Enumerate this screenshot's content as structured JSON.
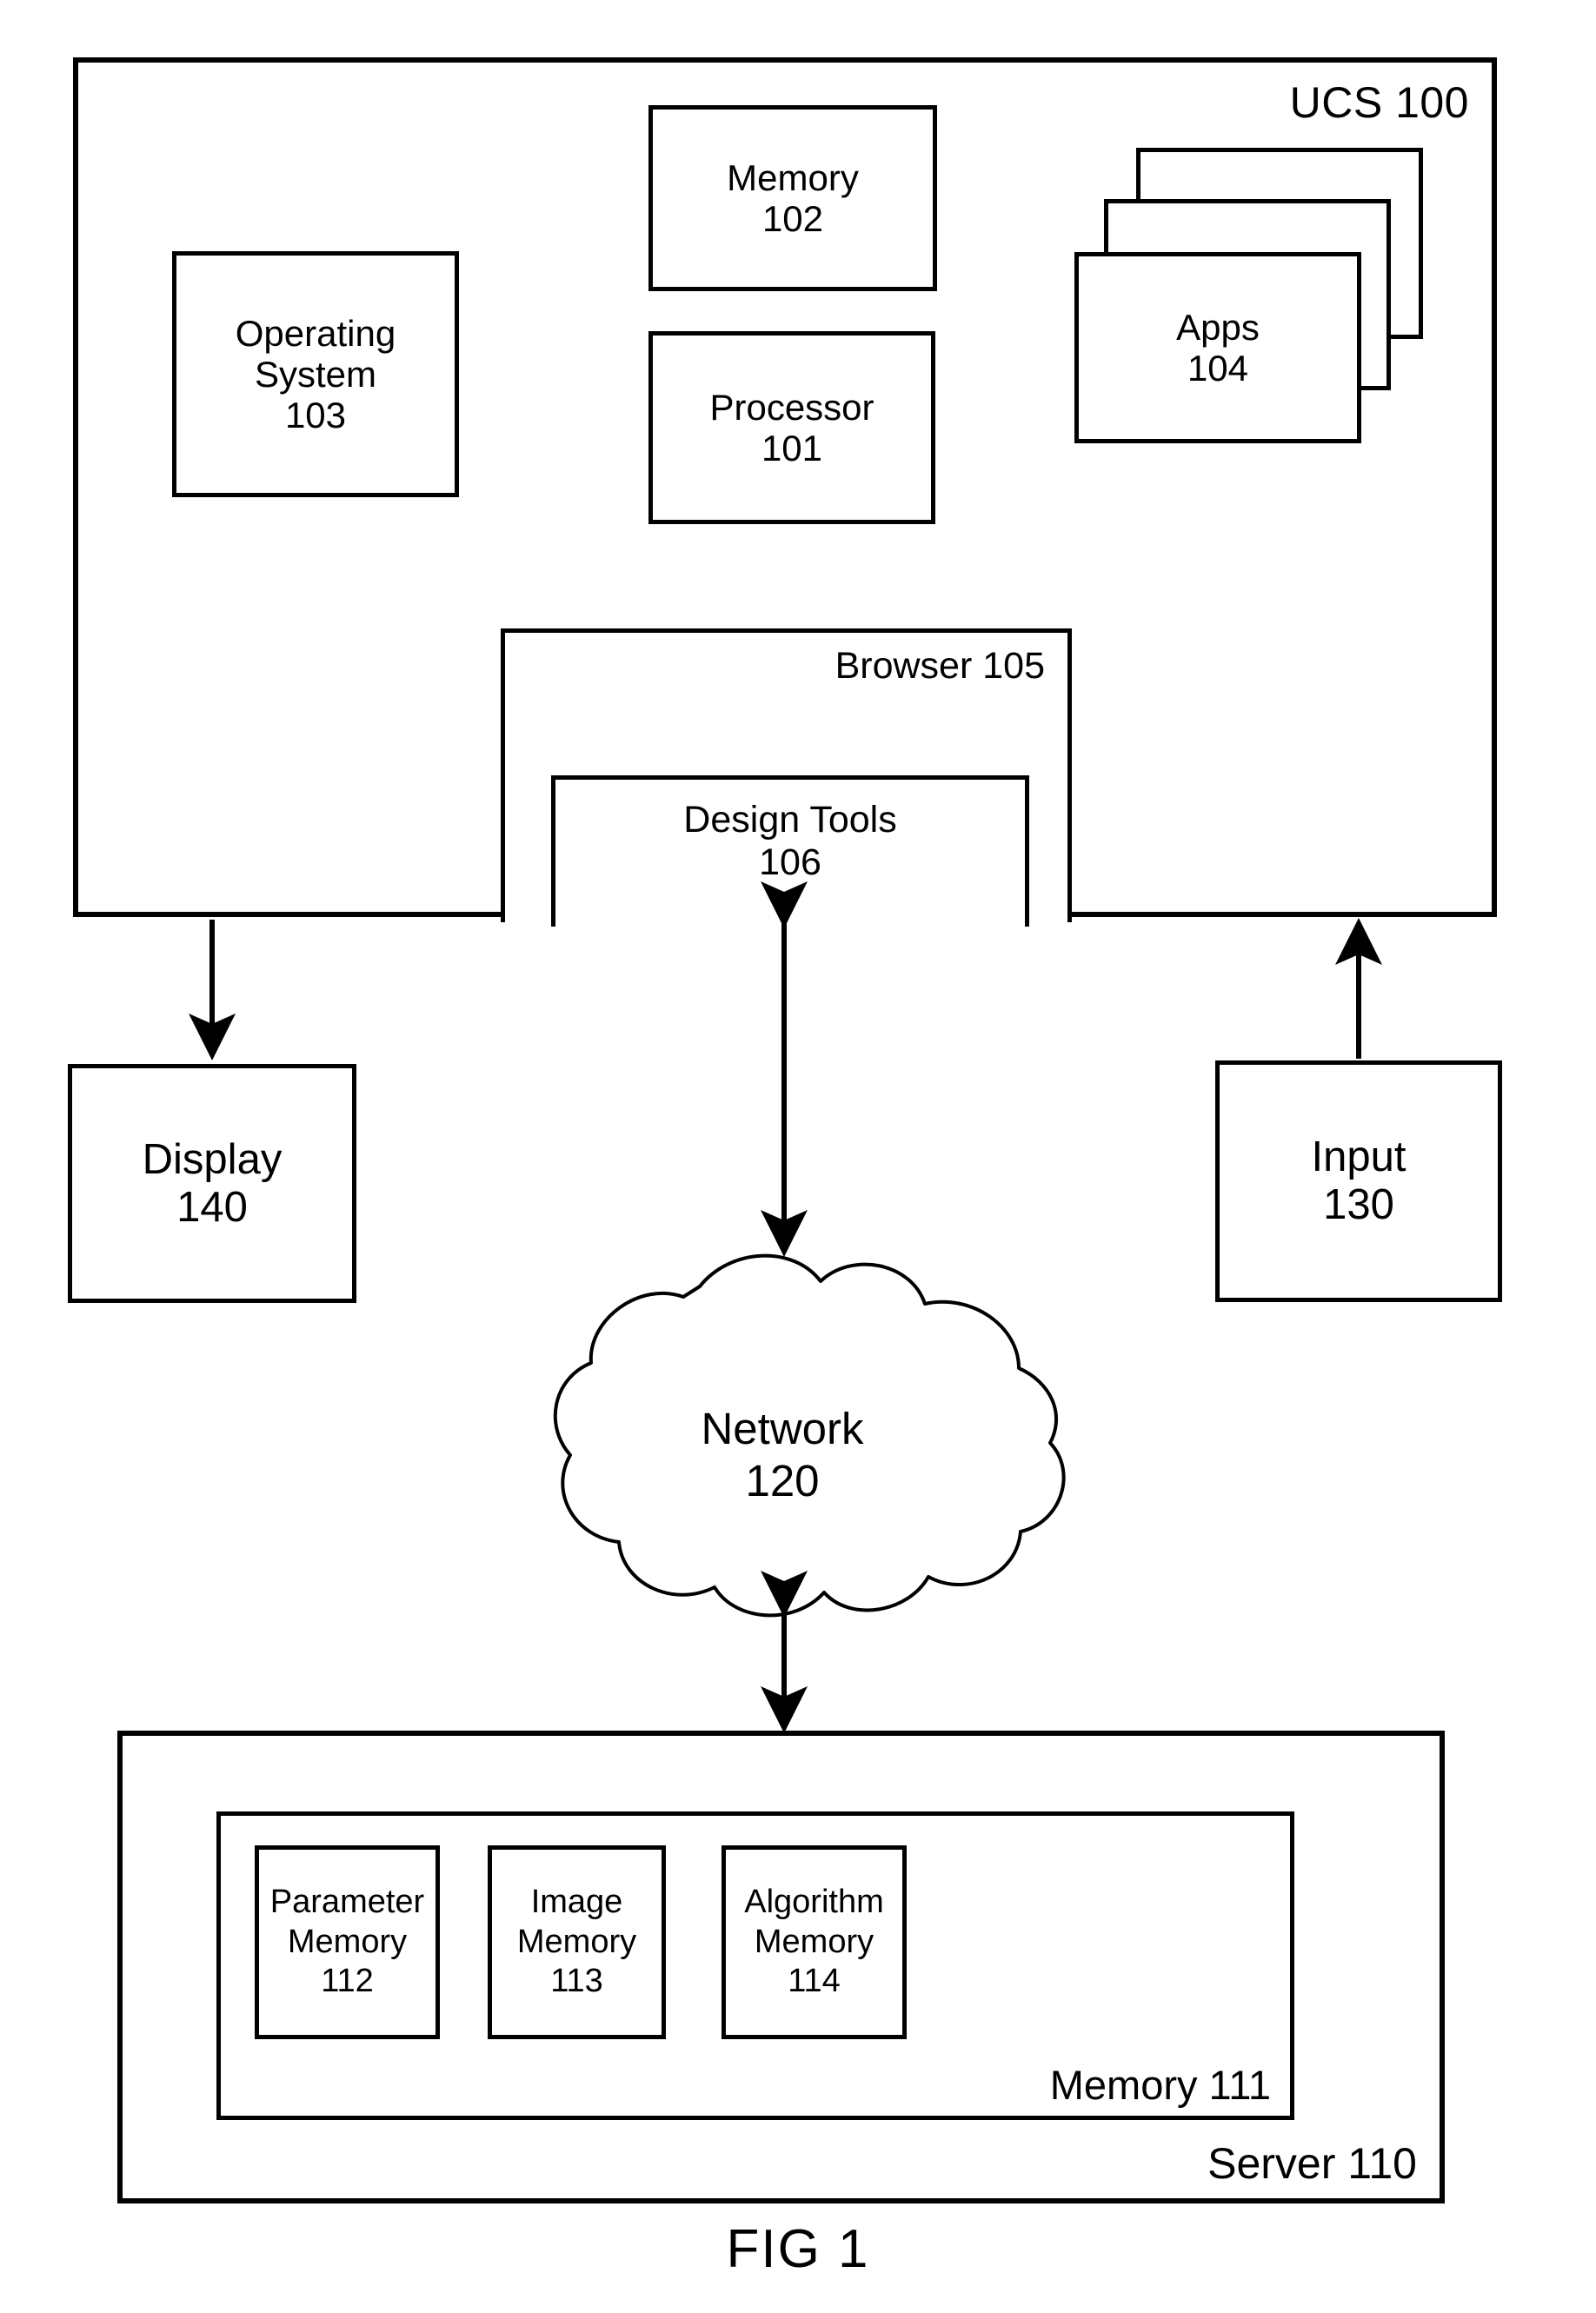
{
  "figure": {
    "caption": "FIG 1"
  },
  "ucs": {
    "title": "UCS 100",
    "operating_system": {
      "name": "Operating System",
      "name_line1": "Operating",
      "name_line2": "System",
      "ref": "103"
    },
    "memory": {
      "name": "Memory",
      "ref": "102"
    },
    "processor": {
      "name": "Processor",
      "ref": "101"
    },
    "apps": {
      "name": "Apps",
      "ref": "104",
      "stack_count": 3
    },
    "browser": {
      "title": "Browser 105"
    },
    "design_tools": {
      "name": "Design Tools",
      "ref": "106"
    }
  },
  "peripherals": {
    "display": {
      "name": "Display",
      "ref": "140"
    },
    "input": {
      "name": "Input",
      "ref": "130"
    }
  },
  "network": {
    "name": "Network",
    "ref": "120"
  },
  "server": {
    "title": "Server 110",
    "memory": {
      "title": "Memory 111"
    },
    "sub_memories": [
      {
        "name_line1": "Parameter",
        "name_line2": "Memory",
        "ref": "112"
      },
      {
        "name_line1": "Image",
        "name_line2": "Memory",
        "ref": "113"
      },
      {
        "name_line1": "Algorithm",
        "name_line2": "Memory",
        "ref": "114"
      }
    ]
  },
  "colors": {
    "stroke": "#000000",
    "background": "#ffffff"
  }
}
